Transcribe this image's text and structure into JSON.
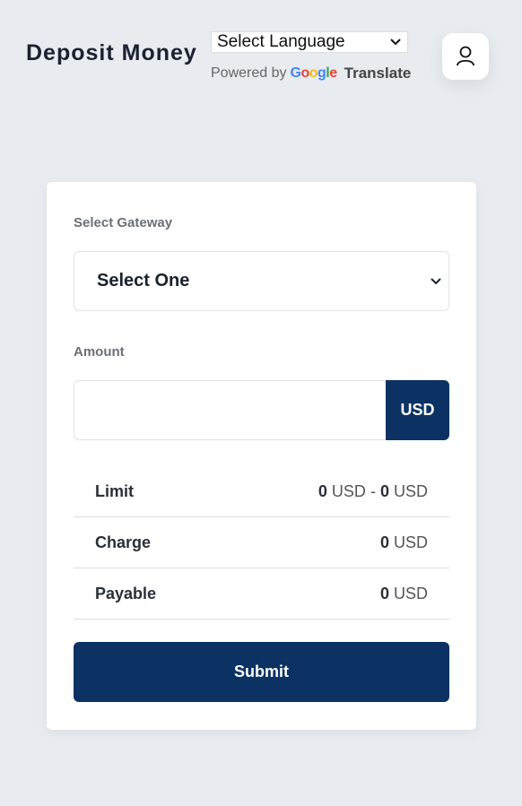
{
  "header": {
    "title": "Deposit Money",
    "language_select": "Select Language",
    "powered_by": "Powered by",
    "google": [
      "G",
      "o",
      "o",
      "g",
      "l",
      "e"
    ],
    "translate": "Translate"
  },
  "form": {
    "gateway_label": "Select Gateway",
    "gateway_value": "Select One",
    "amount_label": "Amount",
    "amount_value": "",
    "currency": "USD"
  },
  "summary": {
    "limit": {
      "label": "Limit",
      "min": "0",
      "max": "0",
      "currency": "USD",
      "sep": "-"
    },
    "charge": {
      "label": "Charge",
      "value": "0",
      "currency": "USD"
    },
    "payable": {
      "label": "Payable",
      "value": "0",
      "currency": "USD"
    }
  },
  "submit_label": "Submit",
  "colors": {
    "primary": "#0b3263",
    "background": "#e8ebf0"
  }
}
